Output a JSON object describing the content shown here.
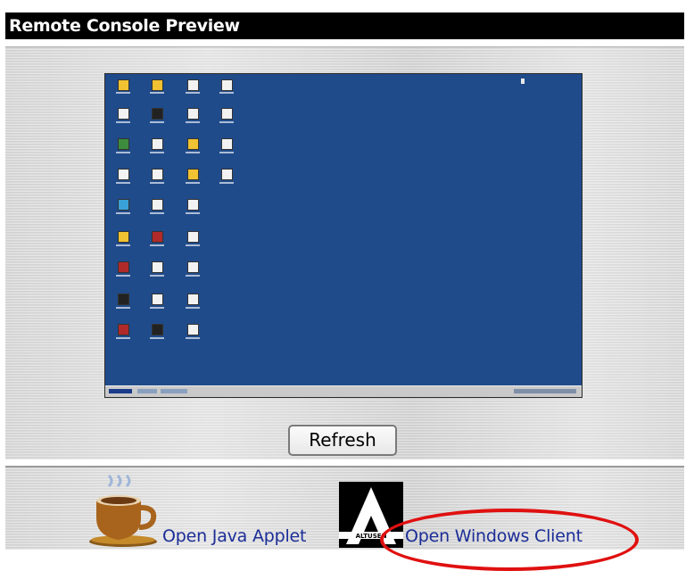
{
  "header": {
    "title": "Remote Console Preview"
  },
  "actions": {
    "refresh_label": "Refresh",
    "java_label": "Open Java Applet",
    "windows_label": "Open Windows Client"
  },
  "logos": {
    "altusen_text": "ALTUSEN"
  },
  "colors": {
    "title_bg": "#000000",
    "link": "#1b2d97",
    "desktop": "#1f4b8a",
    "annotation": "#e01010"
  },
  "icons": [
    "java-cup-icon",
    "altusen-logo-icon"
  ]
}
